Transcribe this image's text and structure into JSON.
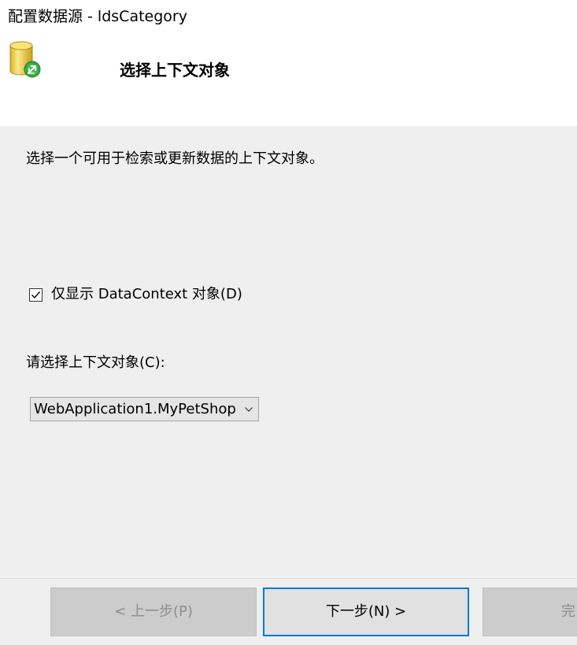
{
  "window": {
    "title": "配置数据源 - ldsCategory"
  },
  "header": {
    "icon": "database-sync-icon",
    "title": "选择上下文对象"
  },
  "body": {
    "description": "选择一个可用于检索或更新数据的上下文对象。",
    "checkbox": {
      "label": "仅显示 DataContext 对象(D)",
      "checked": true
    },
    "select_label": "请选择上下文对象(C):",
    "combo": {
      "value": "WebApplication1.MyPetShop",
      "icon": "chevron-down-icon"
    }
  },
  "footer": {
    "prev_label": "< 上一步(P)",
    "next_label": "下一步(N) >",
    "finish_label": "完"
  },
  "colors": {
    "panel_background": "#efefef",
    "focus_border": "#0078d7",
    "disabled_text": "#8d8d8d",
    "icon_cylinder": "#f2d04a",
    "icon_badge": "#3aa646"
  }
}
